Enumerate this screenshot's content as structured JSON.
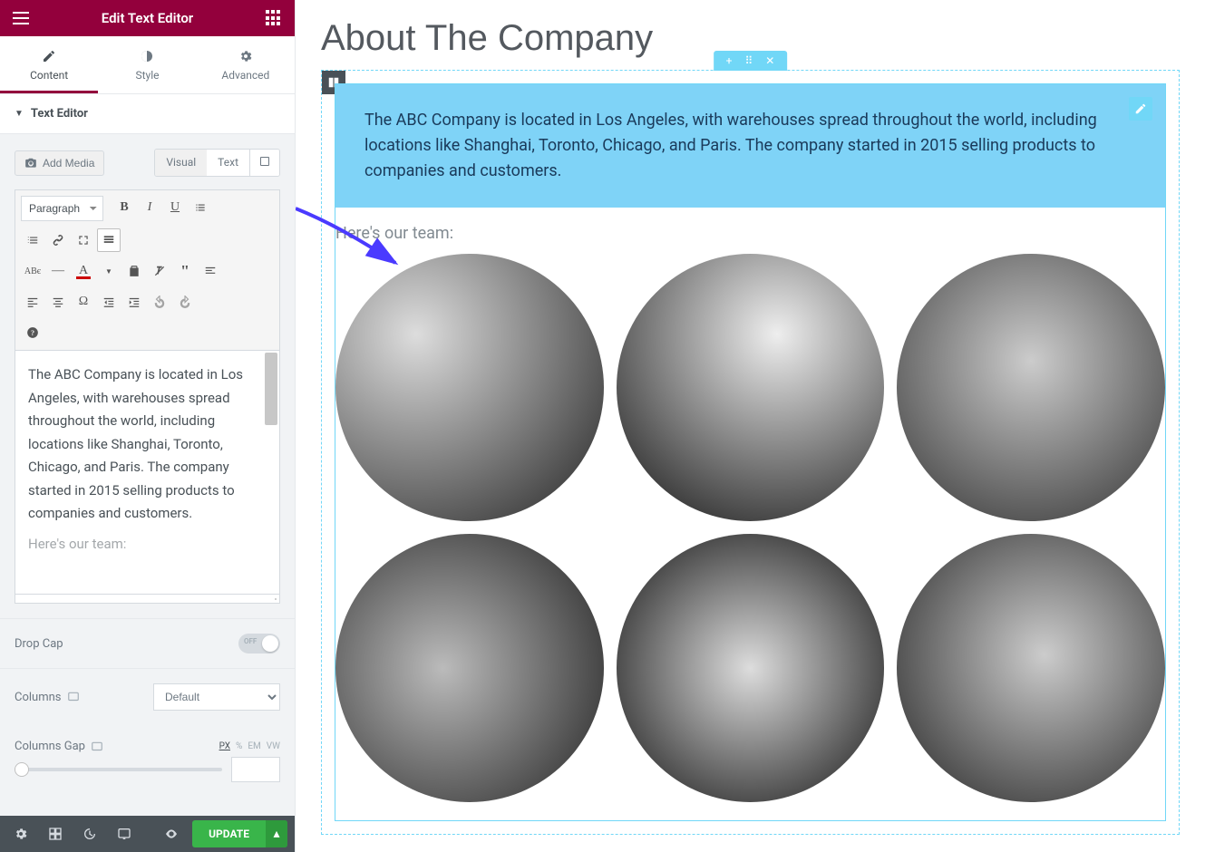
{
  "topbar": {
    "title": "Edit Text Editor"
  },
  "tabs": {
    "content": "Content",
    "style": "Style",
    "advanced": "Advanced"
  },
  "section": {
    "title": "Text Editor"
  },
  "media": {
    "button": "Add Media"
  },
  "wys": {
    "visual": "Visual",
    "text": "Text"
  },
  "format_select": "Paragraph",
  "editor": {
    "p1": "The ABC Company is located in Los Angeles, with warehouses spread throughout the world, including locations like Shanghai, Toronto, Chicago, and Paris. The company started in 2015 selling products to companies and customers.",
    "p2": "Here's our team:"
  },
  "controls": {
    "drop_cap": "Drop Cap",
    "drop_cap_state": "OFF",
    "columns": "Columns",
    "columns_value": "Default",
    "columns_gap": "Columns Gap",
    "units": {
      "px": "PX",
      "pct": "%",
      "em": "EM",
      "vw": "VW"
    }
  },
  "bottombar": {
    "update": "UPDATE"
  },
  "canvas": {
    "page_title": "About The Company",
    "text_block": "The ABC Company is located in Los Angeles, with warehouses spread throughout the world, including locations like Shanghai, Toronto, Chicago, and Paris. The company started in 2015 selling products to companies and customers.",
    "team_heading": "Here's our team:"
  }
}
